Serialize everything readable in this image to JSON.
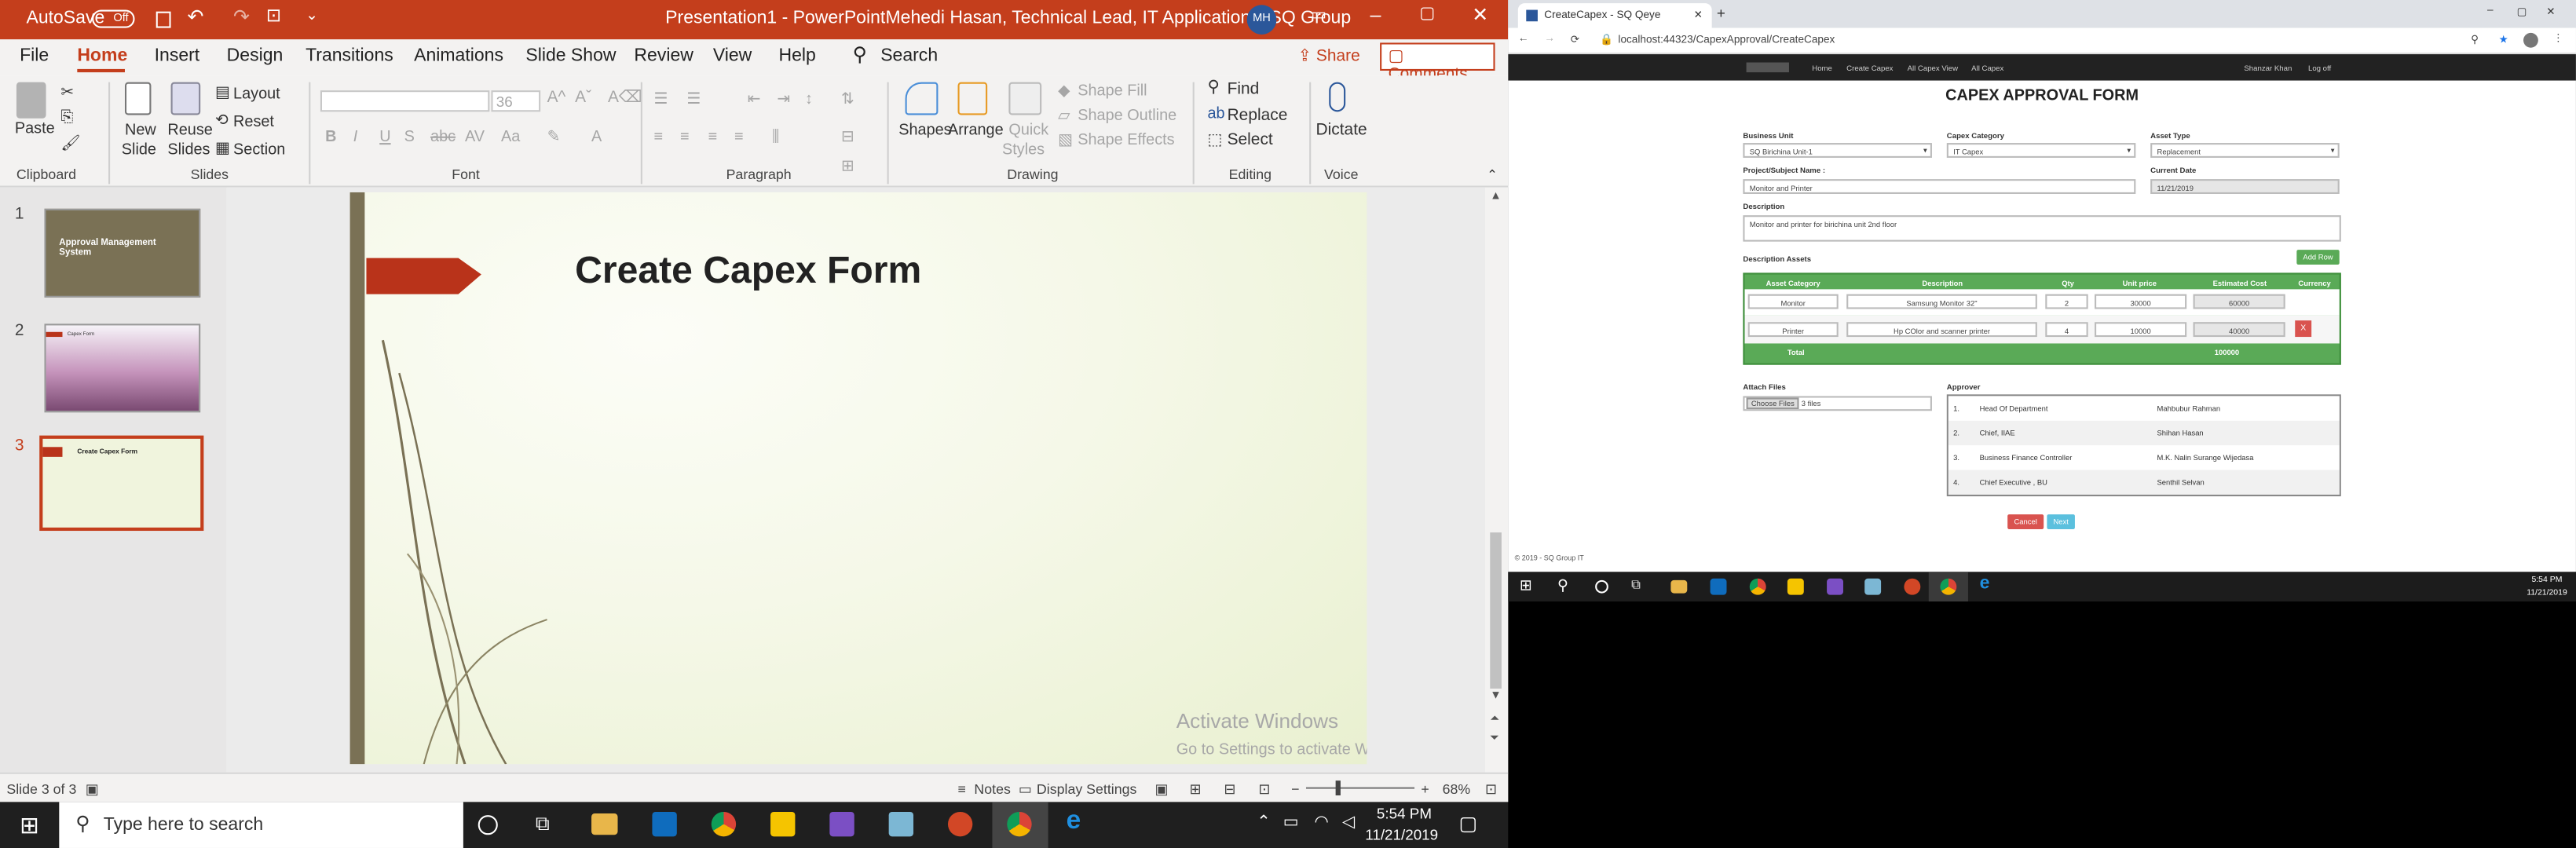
{
  "powerpoint": {
    "autosave_label": "AutoSave",
    "autosave_state": "Off",
    "doc_title": "Presentation1  -  PowerPoint",
    "user_name": "Mehedi Hasan, Technical Lead, IT Applications, SQ Group",
    "user_initials": "MH",
    "tabs": [
      "File",
      "Home",
      "Insert",
      "Design",
      "Transitions",
      "Animations",
      "Slide Show",
      "Review",
      "View",
      "Help"
    ],
    "search_label": "Search",
    "share_label": "Share",
    "comments_label": "Comments",
    "ribbon": {
      "paste": "Paste",
      "clipboard": "Clipboard",
      "new_slide": "New",
      "new_slide2": "Slide",
      "reuse": "Reuse",
      "reuse2": "Slides",
      "layout": "Layout",
      "reset": "Reset",
      "section": "Section",
      "slides_group": "Slides",
      "font_size": "36",
      "font_group": "Font",
      "paragraph_group": "Paragraph",
      "shapes": "Shapes",
      "arrange": "Arrange",
      "quick": "Quick",
      "styles": "Styles",
      "shape_fill": "Shape Fill",
      "shape_outline": "Shape Outline",
      "shape_effects": "Shape Effects",
      "drawing_group": "Drawing",
      "find": "Find",
      "replace": "Replace",
      "select": "Select",
      "editing_group": "Editing",
      "dictate": "Dictate",
      "voice_group": "Voice"
    },
    "thumbnails": [
      {
        "num": "1",
        "title": "Approval Management System"
      },
      {
        "num": "2",
        "title": "Capex Form"
      },
      {
        "num": "3",
        "title": "Create Capex Form"
      }
    ],
    "slide_title": "Create Capex Form",
    "watermark_line1": "Activate Windows",
    "watermark_line2": "Go to Settings to activate Windows.",
    "status": {
      "slide_of": "Slide 3 of 3",
      "notes": "Notes",
      "display_settings": "Display Settings",
      "zoom": "68%"
    }
  },
  "browser": {
    "tab_title": "CreateCapex - SQ Qeye",
    "url": "localhost:44323/CapexApproval/CreateCapex",
    "nav": [
      "Home",
      "Create Capex",
      "All Capex View",
      "All Capex"
    ],
    "user": "Shanzar Khan",
    "logoff": "Log off",
    "form": {
      "heading": "CAPEX APPROVAL FORM",
      "business_unit_label": "Business Unit",
      "business_unit": "SQ Birichina Unit-1",
      "capex_category_label": "Capex Category",
      "capex_category": "IT Capex",
      "asset_type_label": "Asset Type",
      "asset_type": "Replacement",
      "subject_label": "Project/Subject Name :",
      "subject": "Monitor and Printer",
      "current_date_label": "Current Date",
      "current_date": "11/21/2019",
      "description_label": "Description",
      "description": "Monitor and printer for birichina unit 2nd floor",
      "assets_label": "Description Assets",
      "add_row": "Add Row",
      "columns": [
        "Asset Category",
        "Description",
        "Qty",
        "Unit price",
        "Estimated Cost",
        "Currency"
      ],
      "rows": [
        {
          "category": "Monitor",
          "description": "Samsung Monitor 32\"",
          "qty": "2",
          "unit_price": "30000",
          "cost": "60000"
        },
        {
          "category": "Printer",
          "description": "Hp COlor and scanner printer",
          "qty": "4",
          "unit_price": "10000",
          "cost": "40000",
          "remove": "X"
        }
      ],
      "total_label": "Total",
      "total": "100000",
      "attach_label": "Attach Files",
      "choose_files": "Choose Files",
      "files_count": "3 files",
      "approver_label": "Approver",
      "approvers": [
        {
          "n": "1.",
          "role": "Head Of Department",
          "name": "Mahbubur Rahman"
        },
        {
          "n": "2.",
          "role": "Chief, IIAE",
          "name": "Shihan Hasan"
        },
        {
          "n": "3.",
          "role": "Business Finance Controller",
          "name": "M.K. Nalin Surange Wijedasa"
        },
        {
          "n": "4.",
          "role": "Chief Executive , BU",
          "name": "Senthil Selvan"
        }
      ],
      "cancel": "Cancel",
      "next": "Next",
      "footer": "© 2019 - SQ Group IT"
    }
  },
  "taskbar": {
    "search_placeholder": "Type here to search",
    "time": "5:54 PM",
    "date": "11/21/2019",
    "small_time": "5:54 PM",
    "small_date": "11/21/2019"
  },
  "colors": {
    "ppt_red": "#c43e1c",
    "accent_green": "#5aaa57",
    "chrome_tab": "#dee1e6"
  }
}
